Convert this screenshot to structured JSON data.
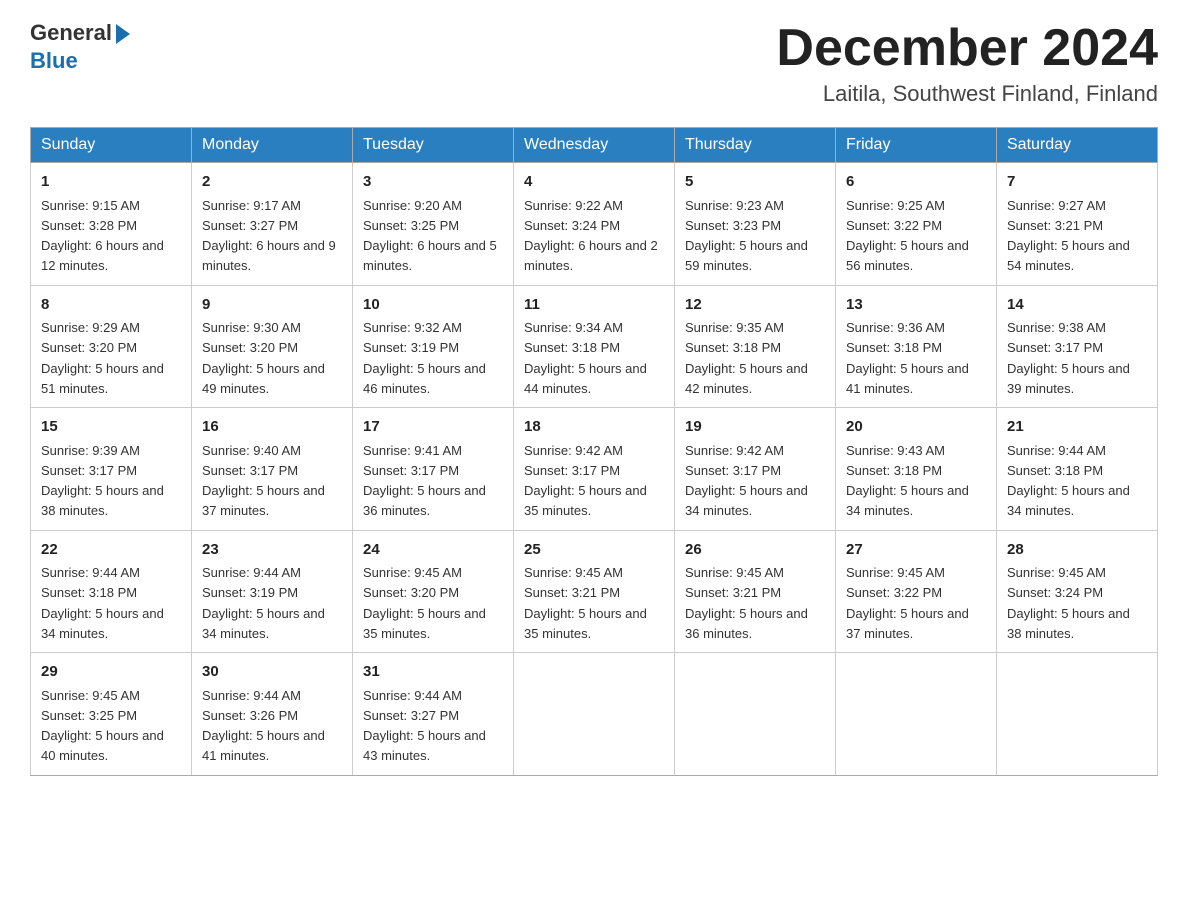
{
  "header": {
    "logo_line1": "General",
    "logo_line2": "Blue",
    "month_title": "December 2024",
    "location": "Laitila, Southwest Finland, Finland"
  },
  "weekdays": [
    "Sunday",
    "Monday",
    "Tuesday",
    "Wednesday",
    "Thursday",
    "Friday",
    "Saturday"
  ],
  "weeks": [
    [
      {
        "day": "1",
        "sunrise": "9:15 AM",
        "sunset": "3:28 PM",
        "daylight": "6 hours and 12 minutes."
      },
      {
        "day": "2",
        "sunrise": "9:17 AM",
        "sunset": "3:27 PM",
        "daylight": "6 hours and 9 minutes."
      },
      {
        "day": "3",
        "sunrise": "9:20 AM",
        "sunset": "3:25 PM",
        "daylight": "6 hours and 5 minutes."
      },
      {
        "day": "4",
        "sunrise": "9:22 AM",
        "sunset": "3:24 PM",
        "daylight": "6 hours and 2 minutes."
      },
      {
        "day": "5",
        "sunrise": "9:23 AM",
        "sunset": "3:23 PM",
        "daylight": "5 hours and 59 minutes."
      },
      {
        "day": "6",
        "sunrise": "9:25 AM",
        "sunset": "3:22 PM",
        "daylight": "5 hours and 56 minutes."
      },
      {
        "day": "7",
        "sunrise": "9:27 AM",
        "sunset": "3:21 PM",
        "daylight": "5 hours and 54 minutes."
      }
    ],
    [
      {
        "day": "8",
        "sunrise": "9:29 AM",
        "sunset": "3:20 PM",
        "daylight": "5 hours and 51 minutes."
      },
      {
        "day": "9",
        "sunrise": "9:30 AM",
        "sunset": "3:20 PM",
        "daylight": "5 hours and 49 minutes."
      },
      {
        "day": "10",
        "sunrise": "9:32 AM",
        "sunset": "3:19 PM",
        "daylight": "5 hours and 46 minutes."
      },
      {
        "day": "11",
        "sunrise": "9:34 AM",
        "sunset": "3:18 PM",
        "daylight": "5 hours and 44 minutes."
      },
      {
        "day": "12",
        "sunrise": "9:35 AM",
        "sunset": "3:18 PM",
        "daylight": "5 hours and 42 minutes."
      },
      {
        "day": "13",
        "sunrise": "9:36 AM",
        "sunset": "3:18 PM",
        "daylight": "5 hours and 41 minutes."
      },
      {
        "day": "14",
        "sunrise": "9:38 AM",
        "sunset": "3:17 PM",
        "daylight": "5 hours and 39 minutes."
      }
    ],
    [
      {
        "day": "15",
        "sunrise": "9:39 AM",
        "sunset": "3:17 PM",
        "daylight": "5 hours and 38 minutes."
      },
      {
        "day": "16",
        "sunrise": "9:40 AM",
        "sunset": "3:17 PM",
        "daylight": "5 hours and 37 minutes."
      },
      {
        "day": "17",
        "sunrise": "9:41 AM",
        "sunset": "3:17 PM",
        "daylight": "5 hours and 36 minutes."
      },
      {
        "day": "18",
        "sunrise": "9:42 AM",
        "sunset": "3:17 PM",
        "daylight": "5 hours and 35 minutes."
      },
      {
        "day": "19",
        "sunrise": "9:42 AM",
        "sunset": "3:17 PM",
        "daylight": "5 hours and 34 minutes."
      },
      {
        "day": "20",
        "sunrise": "9:43 AM",
        "sunset": "3:18 PM",
        "daylight": "5 hours and 34 minutes."
      },
      {
        "day": "21",
        "sunrise": "9:44 AM",
        "sunset": "3:18 PM",
        "daylight": "5 hours and 34 minutes."
      }
    ],
    [
      {
        "day": "22",
        "sunrise": "9:44 AM",
        "sunset": "3:18 PM",
        "daylight": "5 hours and 34 minutes."
      },
      {
        "day": "23",
        "sunrise": "9:44 AM",
        "sunset": "3:19 PM",
        "daylight": "5 hours and 34 minutes."
      },
      {
        "day": "24",
        "sunrise": "9:45 AM",
        "sunset": "3:20 PM",
        "daylight": "5 hours and 35 minutes."
      },
      {
        "day": "25",
        "sunrise": "9:45 AM",
        "sunset": "3:21 PM",
        "daylight": "5 hours and 35 minutes."
      },
      {
        "day": "26",
        "sunrise": "9:45 AM",
        "sunset": "3:21 PM",
        "daylight": "5 hours and 36 minutes."
      },
      {
        "day": "27",
        "sunrise": "9:45 AM",
        "sunset": "3:22 PM",
        "daylight": "5 hours and 37 minutes."
      },
      {
        "day": "28",
        "sunrise": "9:45 AM",
        "sunset": "3:24 PM",
        "daylight": "5 hours and 38 minutes."
      }
    ],
    [
      {
        "day": "29",
        "sunrise": "9:45 AM",
        "sunset": "3:25 PM",
        "daylight": "5 hours and 40 minutes."
      },
      {
        "day": "30",
        "sunrise": "9:44 AM",
        "sunset": "3:26 PM",
        "daylight": "5 hours and 41 minutes."
      },
      {
        "day": "31",
        "sunrise": "9:44 AM",
        "sunset": "3:27 PM",
        "daylight": "5 hours and 43 minutes."
      },
      null,
      null,
      null,
      null
    ]
  ]
}
